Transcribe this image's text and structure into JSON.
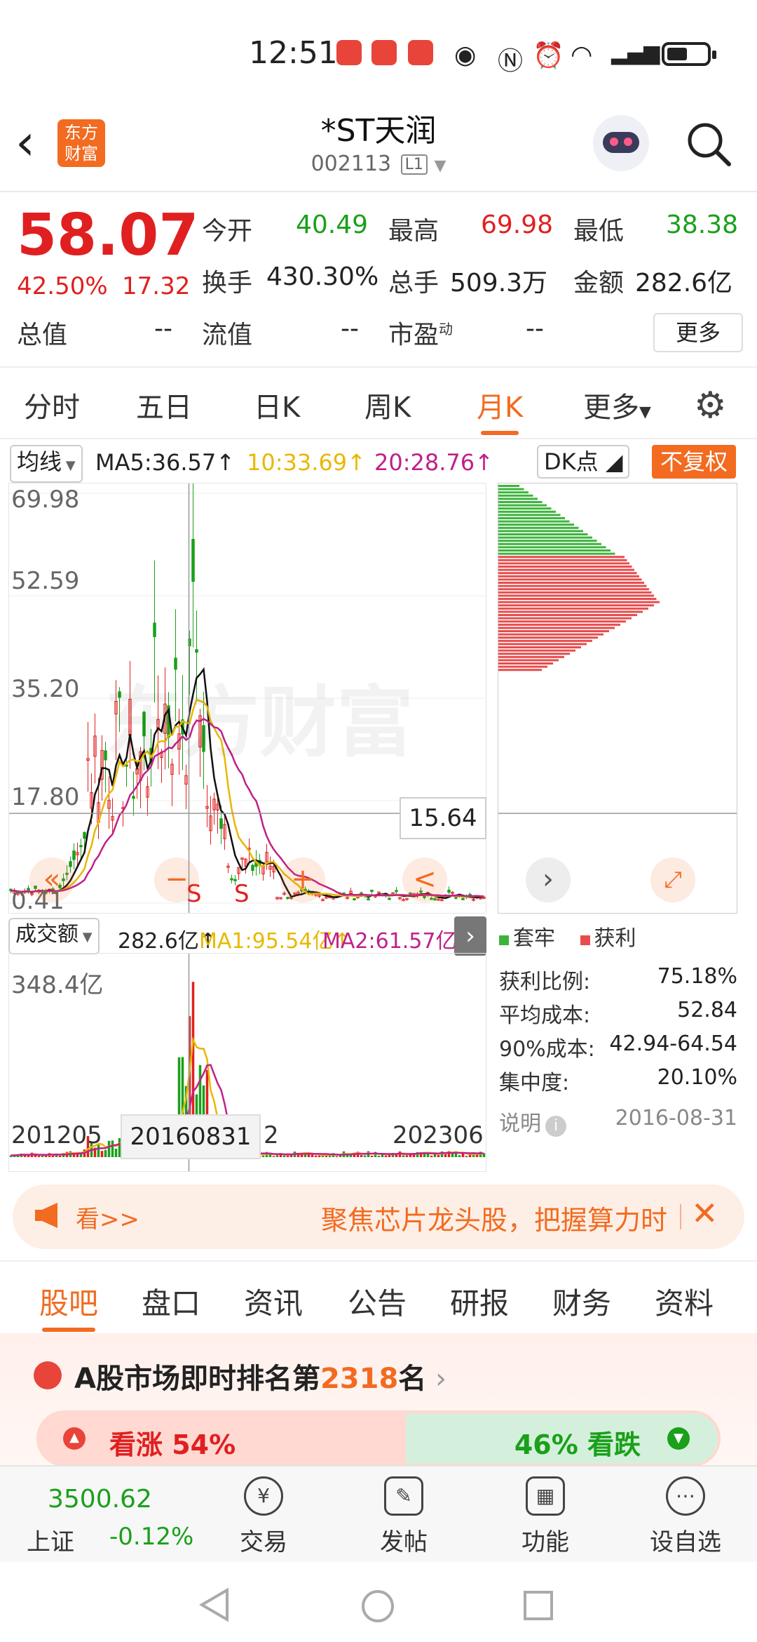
{
  "status_bar": {
    "time": "12:51"
  },
  "header": {
    "title": "*ST天润",
    "code": "002113",
    "level_tag": "L1",
    "logo_text": "东方财富"
  },
  "quote": {
    "price": "58.07",
    "change_pct": "42.50%",
    "change_abs": "17.32",
    "open_label": "今开",
    "open_value": "40.49",
    "high_label": "最高",
    "high_value": "69.98",
    "low_label": "最低",
    "low_value": "38.38",
    "turnover_label": "换手",
    "turnover_value": "430.30%",
    "volume_label": "总手",
    "volume_value": "509.3万",
    "amount_label": "金额",
    "amount_value": "282.6亿",
    "mktcap_label": "总值",
    "mktcap_value": "--",
    "float_label": "流值",
    "float_value": "--",
    "pe_label": "市盈",
    "pe_sup": "动",
    "pe_value": "--",
    "more_button": "更多"
  },
  "period_tabs": [
    "分时",
    "五日",
    "日K",
    "周K",
    "月K",
    "更多"
  ],
  "active_period": "月K",
  "ma_line": {
    "selector": "均线",
    "ma5": "MA5:36.57",
    "ma10": "10:33.69",
    "ma20": "20:28.76",
    "dk_button": "DK点",
    "adjust_button": "不复权"
  },
  "price_axis": [
    "69.98",
    "52.59",
    "35.20",
    "17.80",
    "0.41"
  ],
  "crosshair_price": "15.64",
  "signal_marks": [
    "S",
    "S"
  ],
  "chart_controls": [
    "«",
    "−",
    "+",
    "<"
  ],
  "volume_header": {
    "selector": "成交额",
    "value": "282.6亿",
    "ma1": "MA1:95.54亿",
    "ma2": "MA2:61.57亿"
  },
  "volume_axis_max": "348.4亿",
  "x_axis": {
    "start": "201205",
    "cursor": "20160831",
    "cursor_tail": "2",
    "end": "202306"
  },
  "chip": {
    "legend_trapped": "套牢",
    "legend_profit": "获利",
    "stats": [
      {
        "label": "获利比例:",
        "value": "75.18%"
      },
      {
        "label": "平均成本:",
        "value": "52.84"
      },
      {
        "label": "90%成本:",
        "value": "42.94-64.54"
      },
      {
        "label": "集中度:",
        "value": "20.10%"
      }
    ],
    "note_label": "说明",
    "date": "2016-08-31"
  },
  "banner": {
    "prefix": "看>>",
    "text": "聚焦芯片龙头股，把握算力时"
  },
  "sub_tabs": [
    "股吧",
    "盘口",
    "资讯",
    "公告",
    "研报",
    "财务",
    "资料"
  ],
  "active_sub_tab": "股吧",
  "ranking": {
    "text_prefix": "A股市场即时排名第",
    "rank": "2318",
    "text_suffix": "名"
  },
  "sentiment": {
    "bull_label": "看涨 54%",
    "bear_label": "46% 看跌",
    "bull_pct": 54,
    "bear_pct": 46
  },
  "index": {
    "value": "3500.62",
    "name": "上证",
    "change": "-0.12%"
  },
  "bottom_nav": [
    {
      "label": "交易",
      "icon": "¥"
    },
    {
      "label": "发帖",
      "icon": "✎"
    },
    {
      "label": "功能",
      "icon": "▦"
    },
    {
      "label": "设自选",
      "icon": "⋯"
    }
  ],
  "colors": {
    "accent": "#f26b21",
    "up": "#e02020",
    "down": "#1aa01a",
    "ma10": "#e8b800",
    "ma20": "#c0208a"
  }
}
